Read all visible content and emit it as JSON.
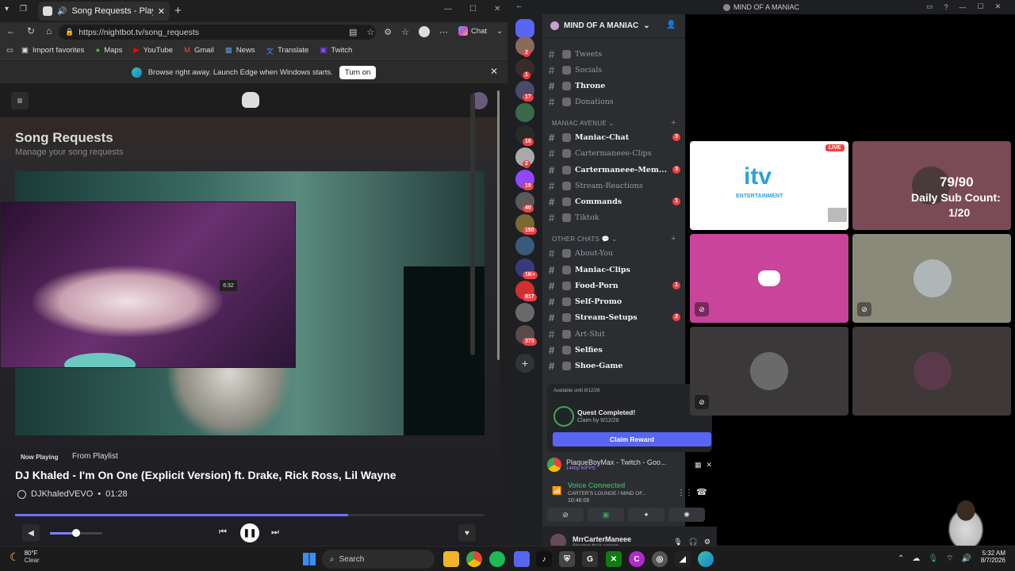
{
  "browser": {
    "tab_title": "Song Requests - Playing DJ K",
    "url": "https://nightbot.tv/song_requests",
    "chat_label": "Chat",
    "favorites": [
      "Import favorites",
      "Maps",
      "YouTube",
      "Gmail",
      "News",
      "Translate",
      "Twitch"
    ],
    "infobar_text": "Browse right away. Launch Edge when Windows starts.",
    "infobar_button": "Turn on"
  },
  "nightbot": {
    "title": "Song Requests",
    "subtitle": "Manage your song requests",
    "now_playing_label": "Now Playing",
    "from_label": "From Playlist",
    "song_title": "DJ Khaled - I'm On One (Explicit Version) ft. Drake, Rick Ross, Lil Wayne",
    "channel": "DJKhaledVEVO",
    "duration": "01:28",
    "progress": 0.71,
    "volume": 0.5,
    "webcam_clock": "6:32"
  },
  "discord": {
    "window_title": "MIND OF A MANIAC",
    "server_name": "MIND OF A MANIAC",
    "guild_badges": [
      "2",
      "1",
      "17",
      "",
      "16",
      "2",
      "19",
      "40",
      "150",
      "",
      "1K+",
      "817",
      "",
      "373"
    ],
    "channels_top": [
      {
        "name": "Tweets",
        "unread": false
      },
      {
        "name": "Socials",
        "unread": false
      },
      {
        "name": "Throne",
        "unread": true
      },
      {
        "name": "Donations",
        "unread": false
      }
    ],
    "category_1": "MANIAC AVENUE",
    "channels_mid": [
      {
        "name": "Maniac-Chat",
        "unread": true,
        "badge": "3"
      },
      {
        "name": "Cartermaneee-Clips",
        "unread": false,
        "badge": ""
      },
      {
        "name": "Cartermaneee-Mem...",
        "unread": true,
        "badge": "3"
      },
      {
        "name": "Stream-Reactions",
        "unread": false,
        "badge": ""
      },
      {
        "name": "Commands",
        "unread": true,
        "badge": "1"
      },
      {
        "name": "Tiktok",
        "unread": false,
        "badge": ""
      }
    ],
    "category_2": "OTHER CHATS",
    "channels_bot": [
      {
        "name": "About-You",
        "unread": false,
        "badge": ""
      },
      {
        "name": "Maniac-Clips",
        "unread": true,
        "badge": ""
      },
      {
        "name": "Food-Porn",
        "unread": true,
        "badge": "1"
      },
      {
        "name": "Self-Promo",
        "unread": true,
        "badge": ""
      },
      {
        "name": "Stream-Setups",
        "unread": true,
        "badge": "2"
      },
      {
        "name": "Art-Shit",
        "unread": false,
        "badge": ""
      },
      {
        "name": "Selfies",
        "unread": true,
        "badge": ""
      },
      {
        "name": "Shoe-Game",
        "unread": true,
        "badge": ""
      }
    ],
    "quest_available": "Available until 8/12/26",
    "quest_title": "Quest Completed!",
    "quest_sub": "Claim by 9/12/26",
    "claim_label": "Claim Reward",
    "activity_name": "PlaqueBoyMax - Twitch - Goo...",
    "activity_sub": "1440p 60FPS",
    "voice_status": "Voice Connected",
    "voice_channel": "CARTER'S LOUNGE / MIND OF...",
    "voice_time": "10:46:06",
    "username": "MrrCarterManeee",
    "user_status": "Sharing their screen"
  },
  "video_grid": {
    "live_badge": "LIVE",
    "itv_name": "itv",
    "itv_sub": "ENTERTAINMENT",
    "overlay_count": "79/90",
    "overlay_label": "Daily Sub Count:",
    "overlay_sub": "1/20"
  },
  "taskbar": {
    "weather_temp": "80°F",
    "weather_desc": "Clear",
    "search_label": "Search",
    "time": "5:32 AM",
    "date": "8/7/2026"
  },
  "colors": {
    "discord_blurple": "#5865f2",
    "discord_pink": "#c9449b",
    "live_red": "#ed4245",
    "nightbot_progress": "#6f6fff"
  }
}
